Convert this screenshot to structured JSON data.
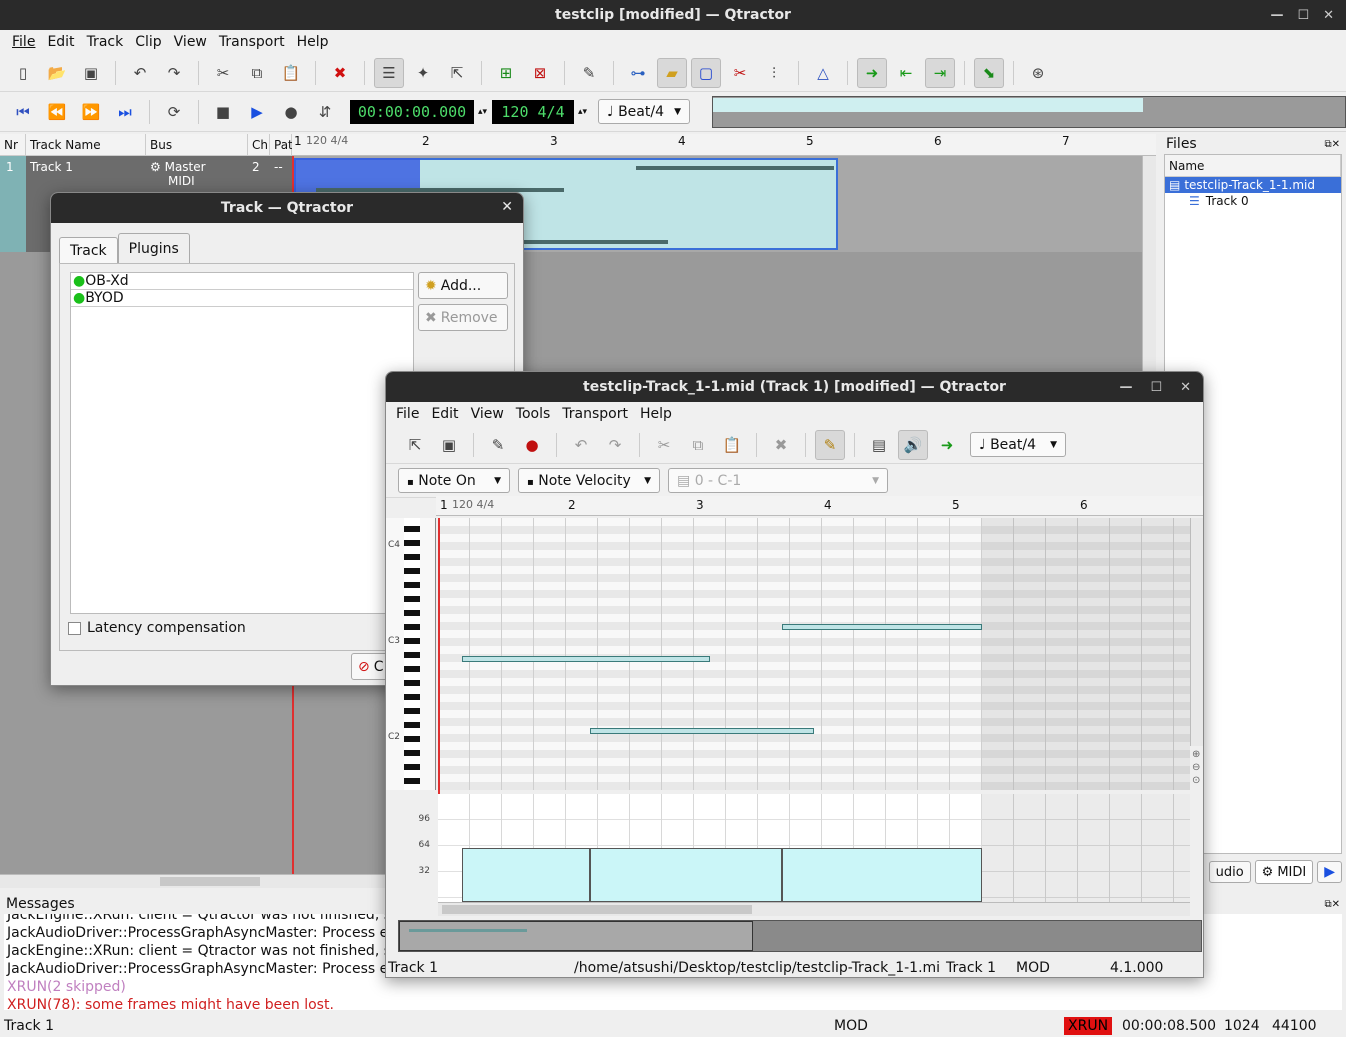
{
  "main": {
    "title": "testclip [modified] — Qtractor",
    "menu": [
      "File",
      "Edit",
      "Track",
      "Clip",
      "View",
      "Transport",
      "Help"
    ],
    "time_display": "00:00:00.000",
    "tempo_display": "120 4/4",
    "snap": "Beat/4",
    "track_headers": {
      "nr": "Nr",
      "name": "Track Name",
      "bus": "Bus",
      "ch": "Ch",
      "pat": "Pat"
    },
    "track": {
      "nr": "1",
      "name": "Track 1",
      "bus": "Master",
      "bus2": "MIDI",
      "ch": "2"
    },
    "ruler": {
      "tempo": "120 4/4",
      "bars": [
        "1",
        "2",
        "3",
        "4",
        "5",
        "6",
        "7"
      ]
    },
    "files": {
      "title": "Files",
      "col": "Name",
      "file": "testclip-Track_1-1.mid",
      "child": "Track 0",
      "tab_audio": "udio",
      "tab_midi": "MIDI"
    },
    "messages": {
      "title": "Messages",
      "lines": [
        "JackEngine::XRun: client = Qtractor was not finished, st",
        "JackAudioDriver::ProcessGraphAsyncMaster: Process er",
        "JackEngine::XRun: client = Qtractor was not finished, sta",
        "JackAudioDriver::ProcessGraphAsyncMaster: Process er"
      ],
      "xrun_skipped": "XRUN(2 skipped)",
      "xrun_lost": "XRUN(78): some frames might have been lost."
    },
    "status": {
      "track": "Track 1",
      "mod": "MOD",
      "xrun": "XRUN",
      "time": "00:00:08.500",
      "buf": "1024",
      "rate": "44100"
    }
  },
  "track_dialog": {
    "title": "Track — Qtractor",
    "tab_track": "Track",
    "tab_plugins": "Plugins",
    "plugins": [
      "OB-Xd",
      "BYOD"
    ],
    "add": "Add...",
    "remove": "Remove",
    "latency": "Latency compensation",
    "close": "C"
  },
  "editor": {
    "title": "testclip-Track_1-1.mid (Track 1) [modified] — Qtractor",
    "menu": [
      "File",
      "Edit",
      "View",
      "Tools",
      "Transport",
      "Help"
    ],
    "snap": "Beat/4",
    "event_type": "Note On",
    "value_type": "Note Velocity",
    "note_combo": "0 - C-1",
    "ruler": {
      "tempo": "120 4/4",
      "bars": [
        "1",
        "2",
        "3",
        "4",
        "5",
        "6"
      ]
    },
    "keys": [
      "C4",
      "C3",
      "C2"
    ],
    "vel_ticks": [
      "96",
      "64",
      "32"
    ],
    "status": {
      "track": "Track 1",
      "path": "/home/atsushi/Desktop/testclip/testclip-Track_1-1.mi",
      "track2": "Track 1",
      "mod": "MOD",
      "version": "4.1.000"
    }
  },
  "colors": {
    "accent": "#3a6fd8",
    "clip": "#bfe4e6",
    "lcd_green": "#4ddc6a",
    "xrun_red": "#e01010"
  }
}
